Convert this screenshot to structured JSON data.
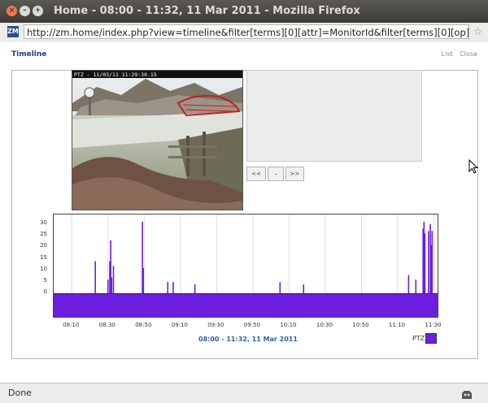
{
  "window": {
    "title": "Home - 08:00 - 11:32, 11 Mar 2011 - Mozilla Firefox",
    "close_glyph": "×",
    "min_glyph": "–",
    "max_glyph": "+"
  },
  "browser": {
    "favicon_text": "ZM",
    "url": "http://zm.home/index.php?view=timeline&filter[terms][0][attr]=MonitorId&filter[terms][0][op]=%3D&filter",
    "bookmark_icon": "☆",
    "status": "Done"
  },
  "page": {
    "title": "Timeline",
    "links": [
      "List",
      "Close"
    ]
  },
  "camera": {
    "overlay_text": "PTZ - 11/03/11 11:29:30.15"
  },
  "nav": {
    "prev": "<<",
    "zoom_out": "–",
    "next": ">>"
  },
  "chart_data": {
    "type": "bar",
    "ylim": [
      -10,
      32
    ],
    "yticks": [
      0,
      5,
      10,
      15,
      20,
      25,
      30
    ],
    "xticks": [
      "08:10",
      "08:30",
      "08:50",
      "09:10",
      "09:30",
      "09:50",
      "10:10",
      "10:30",
      "10:50",
      "11:10",
      "11:30"
    ],
    "x_range_minutes": [
      480,
      692
    ],
    "range_label": "08:00 - 11:32, 11 Mar 2011",
    "series": [
      {
        "name": "PTZ",
        "color": "#6c1fe0",
        "events": [
          {
            "t": 503,
            "v": 14
          },
          {
            "t": 510,
            "v": 6
          },
          {
            "t": 511,
            "v": 14
          },
          {
            "t": 511.5,
            "v": 23
          },
          {
            "t": 512,
            "v": 7
          },
          {
            "t": 513,
            "v": 12
          },
          {
            "t": 529,
            "v": 31
          },
          {
            "t": 529.5,
            "v": 11
          },
          {
            "t": 543,
            "v": 5
          },
          {
            "t": 546,
            "v": 5
          },
          {
            "t": 558,
            "v": 4
          },
          {
            "t": 605,
            "v": 5
          },
          {
            "t": 618,
            "v": 4
          },
          {
            "t": 676,
            "v": 8
          },
          {
            "t": 680,
            "v": 6
          },
          {
            "t": 684,
            "v": 28
          },
          {
            "t": 684.5,
            "v": 31
          },
          {
            "t": 685,
            "v": 26
          },
          {
            "t": 687,
            "v": 27
          },
          {
            "t": 688,
            "v": 30
          },
          {
            "t": 688.5,
            "v": 21
          },
          {
            "t": 689,
            "v": 27
          }
        ]
      }
    ]
  },
  "colors": {
    "accent": "#6c1fe0",
    "link": "#2a63a8",
    "title": "#1a3f7a"
  }
}
